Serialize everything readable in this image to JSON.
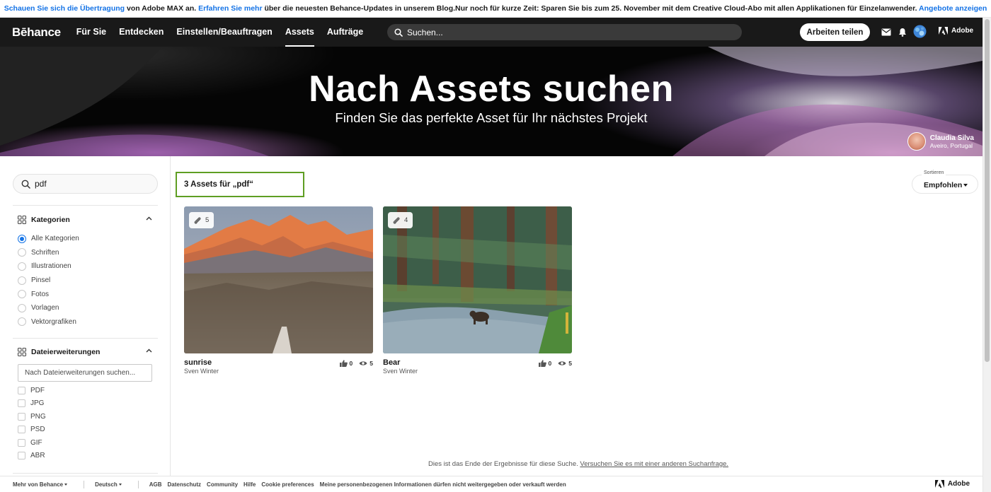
{
  "promo": {
    "link1": "Schauen Sie sich die Übertragung",
    "text1": " von Adobe MAX an. ",
    "link2": "Erfahren Sie mehr",
    "text2": " über die neuesten Behance-Updates in unserem Blog.Nur noch für kurze Zeit: Sparen Sie bis zum 25. November mit dem Creative Cloud-Abo mit allen Applikationen für Einzelanwender. ",
    "link3": "Angebote anzeigen"
  },
  "nav": {
    "logo": "Bēhance",
    "links": [
      "Für Sie",
      "Entdecken",
      "Einstellen/Beauftragen",
      "Assets",
      "Aufträge"
    ],
    "active_index": 3,
    "search_placeholder": "Suchen...",
    "share_button": "Arbeiten teilen",
    "adobe": "Adobe"
  },
  "hero": {
    "title": "Nach Assets suchen",
    "subtitle": "Finden Sie das perfekte Asset für Ihr nächstes Projekt",
    "credit_name": "Claudia Silva",
    "credit_location": "Aveiro, Portugal"
  },
  "sidebar": {
    "search_value": "pdf",
    "categories_title": "Kategorien",
    "categories": [
      "Alle Kategorien",
      "Schriften",
      "Illustrationen",
      "Pinsel",
      "Fotos",
      "Vorlagen",
      "Vektorgrafiken"
    ],
    "selected_category": 0,
    "extensions_title": "Dateierweiterungen",
    "extensions_placeholder": "Nach Dateierweiterungen suchen...",
    "extensions": [
      "PDF",
      "JPG",
      "PNG",
      "PSD",
      "GIF",
      "ABR"
    ]
  },
  "results": {
    "count_label": "3 Assets für „pdf“",
    "sort_label": "Sortieren",
    "sort_value": "Empfohlen",
    "cards": [
      {
        "title": "sunrise",
        "author": "Sven Winter",
        "attachments": "5",
        "likes": "0",
        "views": "5"
      },
      {
        "title": "Bear",
        "author": "Sven Winter",
        "attachments": "4",
        "likes": "0",
        "views": "5"
      }
    ],
    "end_text": "Dies ist das Ende der Ergebnisse für diese Suche. ",
    "end_link": "Versuchen Sie es mit einer anderen Suchanfrage."
  },
  "footer": {
    "more": "Mehr von Behance",
    "language": "Deutsch",
    "links": [
      "AGB",
      "Datenschutz",
      "Community",
      "Hilfe",
      "Cookie preferences",
      "Meine personenbezogenen Informationen dürfen nicht weitergegeben oder verkauft werden"
    ],
    "adobe": "Adobe"
  },
  "colors": {
    "accent": "#1473e6",
    "highlight_border": "#5f9e23",
    "nav_bg": "#191919"
  }
}
